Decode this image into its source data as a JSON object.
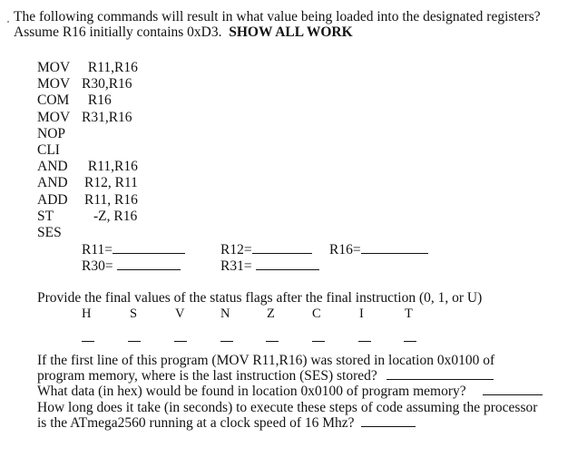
{
  "intro": {
    "line1": "The following commands will result in what value being loaded into the designated registers?",
    "line2_prefix": "Assume R16 initially contains 0xD3.",
    "line2_bold": "SHOW ALL WORK"
  },
  "code": [
    {
      "op": "MOV",
      "args": " R11,R16"
    },
    {
      "op": "MOV",
      "args": "R30,R16"
    },
    {
      "op": "COM",
      "args": " R16"
    },
    {
      "op": "MOV",
      "args": "R31,R16"
    },
    {
      "op": "NOP",
      "args": ""
    },
    {
      "op": "CLI",
      "args": ""
    },
    {
      "op": "AND",
      "args": " R11,R16"
    },
    {
      "op": "AND",
      "args": "R12, R11"
    },
    {
      "op": "ADD",
      "args": "R11, R16"
    },
    {
      "op": "ST",
      "args": "-Z, R16"
    },
    {
      "op": "SES",
      "args": ""
    }
  ],
  "registers": {
    "r11": "R11=",
    "r12": "R12=",
    "r16": "R16=",
    "r30": "R30=",
    "r31": "R31="
  },
  "flags": {
    "prompt": "Provide the final values of the status flags after the final instruction (0, 1, or U)",
    "names": [
      "H",
      "S",
      "V",
      "N",
      "Z",
      "C",
      "I",
      "T"
    ]
  },
  "questions": {
    "q1_line1": "If the first line of this program (MOV R11,R16) was stored in location 0x0100 of",
    "q1_line2": "program memory, where is the last instruction (SES) stored?",
    "q2": "What data (in hex) would be found in location 0x0100 of program memory?",
    "q3_line1": "How long does it take (in seconds) to execute these steps of code assuming the processor",
    "q3_line2": "is the ATmega2560 running at a clock speed of 16 Mhz?"
  }
}
